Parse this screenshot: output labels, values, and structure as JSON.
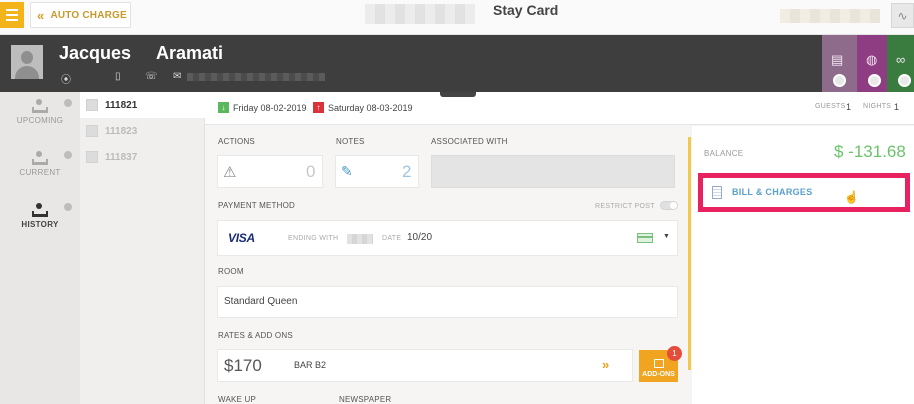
{
  "topbar": {
    "auto_charge_label": "AUTO CHARGE",
    "title": "Stay Card"
  },
  "guest": {
    "first_name": "Jacques",
    "last_name": "Aramati"
  },
  "tiles": [
    {
      "color": "#8e6b8b",
      "icon": "phone-icon"
    },
    {
      "color": "#8e3d82",
      "icon": "globe-icon"
    },
    {
      "color": "#3a7b3f",
      "icon": "link-icon"
    }
  ],
  "sidebar": {
    "items": [
      {
        "label": "UPCOMING",
        "active": false
      },
      {
        "label": "CURRENT",
        "active": false
      },
      {
        "label": "HISTORY",
        "active": true
      }
    ]
  },
  "reservations": [
    {
      "number": "111821",
      "selected": true
    },
    {
      "number": "111823",
      "selected": false
    },
    {
      "number": "111837",
      "selected": false
    }
  ],
  "stay": {
    "arrival": "Friday 08-02-2019",
    "departure": "Saturday 08-03-2019",
    "guests_label": "GUESTS",
    "guests": "1",
    "nights_label": "NIGHTS",
    "nights": "1"
  },
  "sections": {
    "actions_label": "ACTIONS",
    "actions_count": "0",
    "notes_label": "NOTES",
    "notes_count": "2",
    "associated_label": "ASSOCIATED WITH",
    "payment_label": "PAYMENT METHOD",
    "restrict_post_label": "RESTRICT POST",
    "card_brand": "VISA",
    "ending_with_label": "ENDING WITH",
    "date_label": "DATE",
    "expiry": "10/20",
    "room_label": "ROOM",
    "room_type": "Standard Queen",
    "rates_label": "RATES & ADD ONS",
    "rate_amount": "$170",
    "rate_code": "BAR B2",
    "addons_label": "ADD-ONS",
    "addons_count": "1",
    "wakeup_label": "WAKE UP",
    "newspaper_label": "NEWSPAPER"
  },
  "balance": {
    "label": "BALANCE",
    "value": "$ -131.68"
  },
  "bill_button": {
    "label": "BILL & CHARGES"
  },
  "colors": {
    "accent_yellow": "#f3b41b",
    "guest_bar": "#3e3e3e",
    "balance_green": "#6ac36a",
    "highlight_pink": "#e8225e"
  }
}
